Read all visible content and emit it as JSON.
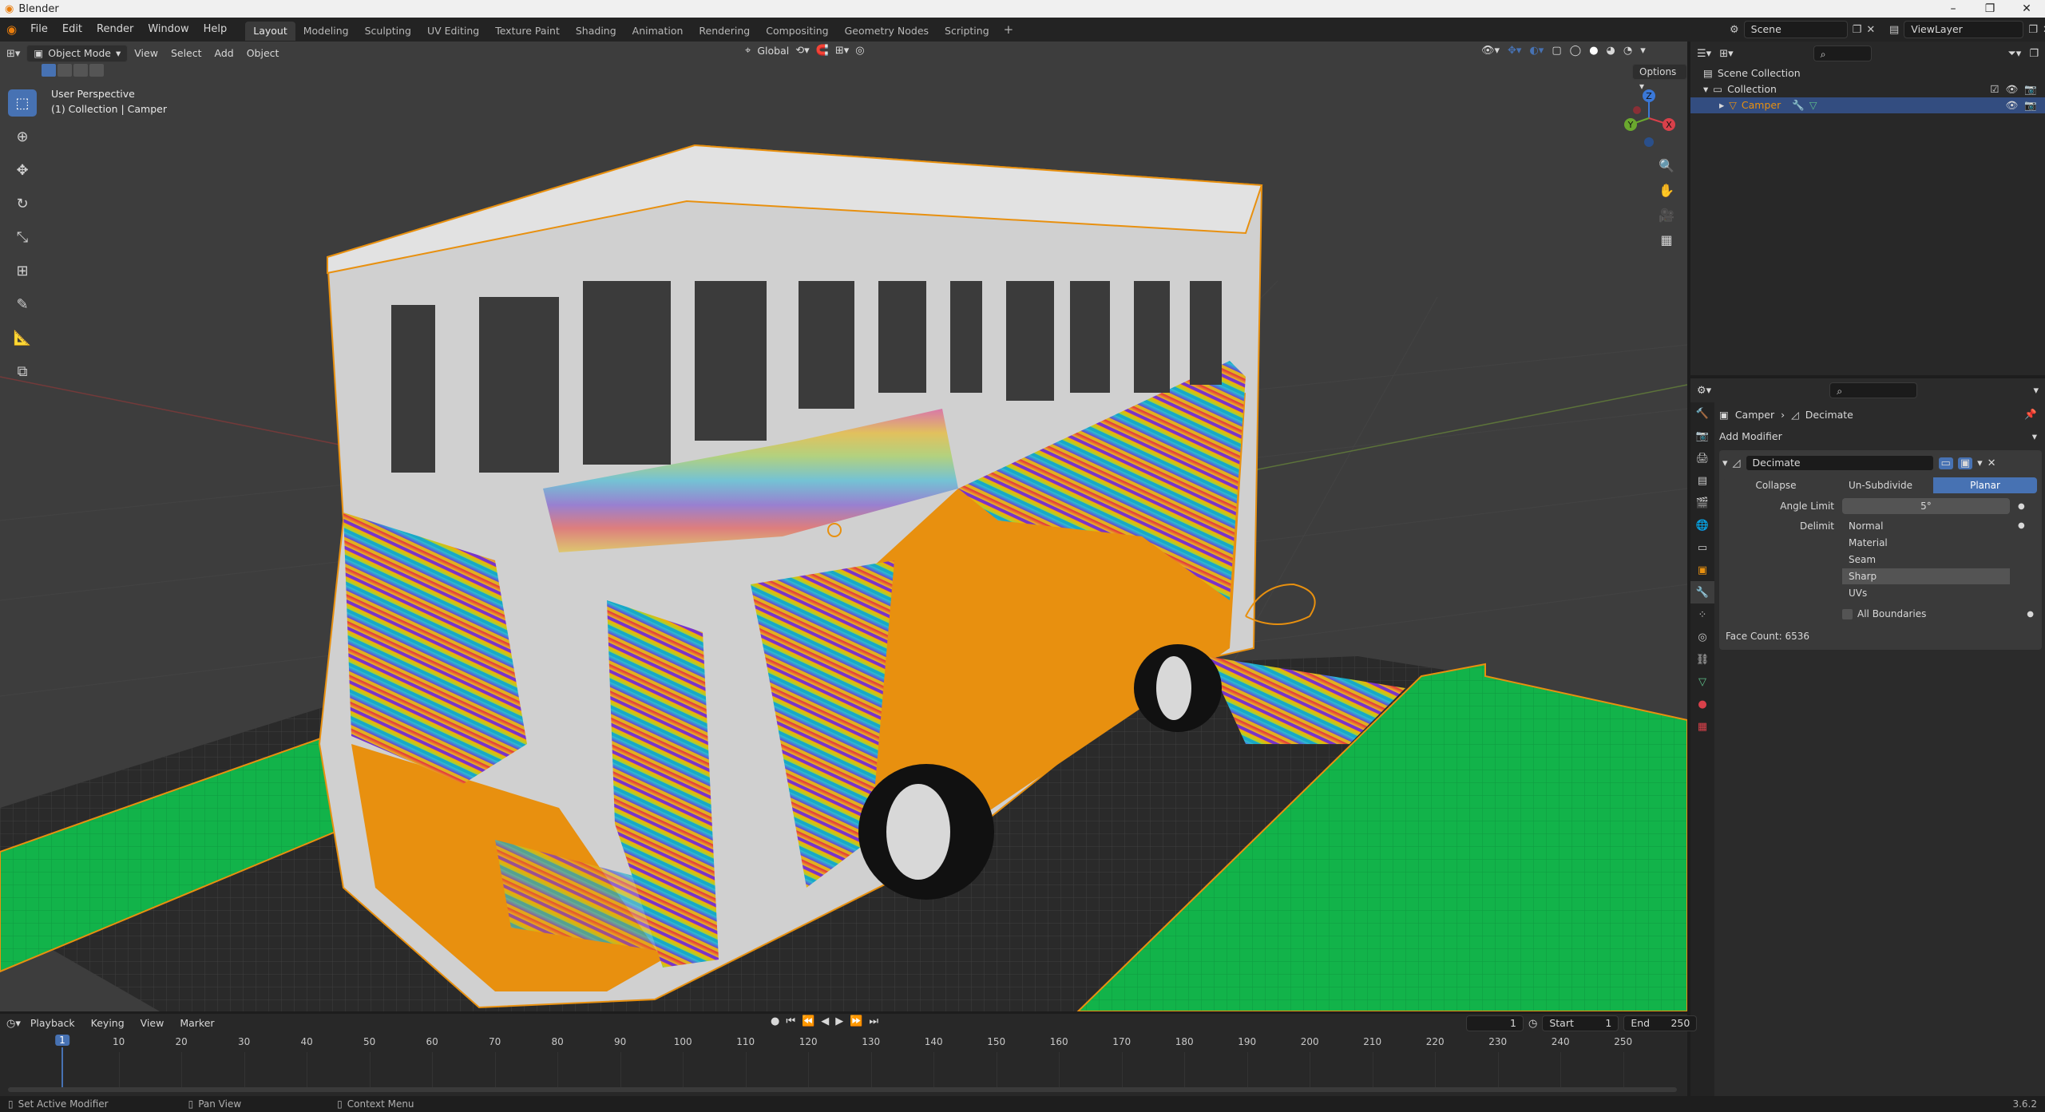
{
  "app": {
    "title": "Blender",
    "version": "3.6.2"
  },
  "window_controls": [
    "–",
    "❐",
    "✕"
  ],
  "menus": [
    "File",
    "Edit",
    "Render",
    "Window",
    "Help"
  ],
  "workspaces": [
    "Layout",
    "Modeling",
    "Sculpting",
    "UV Editing",
    "Texture Paint",
    "Shading",
    "Animation",
    "Rendering",
    "Compositing",
    "Geometry Nodes",
    "Scripting"
  ],
  "active_workspace": "Layout",
  "scene": {
    "label": "Scene",
    "view_layer": "ViewLayer"
  },
  "viewport": {
    "mode": "Object Mode",
    "header_menus": [
      "View",
      "Select",
      "Add",
      "Object"
    ],
    "transform_orientation": "Global",
    "options_label": "Options",
    "overlay_title": "User Perspective",
    "overlay_subtitle": "(1) Collection | Camper",
    "axes": {
      "x": "X",
      "y": "Y",
      "z": "Z"
    }
  },
  "outliner": {
    "root": "Scene Collection",
    "collection": "Collection",
    "object": "Camper"
  },
  "properties": {
    "breadcrumb_object": "Camper",
    "breadcrumb_modifier": "Decimate",
    "add_modifier": "Add Modifier",
    "modifier_name": "Decimate",
    "modes": [
      "Collapse",
      "Un-Subdivide",
      "Planar"
    ],
    "active_mode": "Planar",
    "angle_limit_label": "Angle Limit",
    "angle_limit_value": "5°",
    "delimit_label": "Delimit",
    "delimit_options": [
      {
        "label": "Normal",
        "on": false
      },
      {
        "label": "Material",
        "on": false
      },
      {
        "label": "Seam",
        "on": false
      },
      {
        "label": "Sharp",
        "on": true
      },
      {
        "label": "UVs",
        "on": false
      }
    ],
    "all_boundaries": "All Boundaries",
    "face_count": "Face Count: 6536"
  },
  "timeline": {
    "menus": [
      "Playback",
      "Keying",
      "View",
      "Marker"
    ],
    "current_frame": "1",
    "start_label": "Start",
    "start": "1",
    "end_label": "End",
    "end": "250",
    "ticks": [
      "10",
      "20",
      "30",
      "40",
      "50",
      "60",
      "70",
      "80",
      "90",
      "100",
      "110",
      "120",
      "130",
      "140",
      "150",
      "160",
      "170",
      "180",
      "190",
      "200",
      "210",
      "220",
      "230",
      "240",
      "250"
    ],
    "playhead": "1"
  },
  "statusbar": {
    "left": "Set Active Modifier",
    "middle": "Pan View",
    "right": "Context Menu"
  },
  "colors": {
    "accent": "#4772b3",
    "orange": "#e8900f",
    "green": "#12b34a",
    "white_body": "#cfcfcf"
  }
}
